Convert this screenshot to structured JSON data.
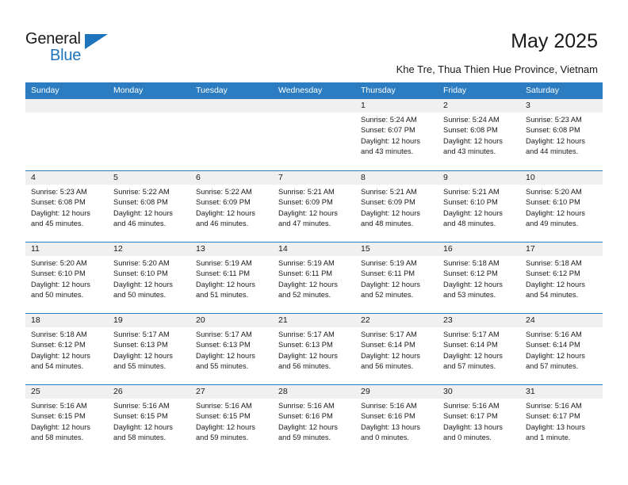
{
  "brand": {
    "name_top": "General",
    "name_bottom": "Blue",
    "accent_color": "#1d74bb"
  },
  "header": {
    "month_title": "May 2025",
    "location": "Khe Tre, Thua Thien Hue Province, Vietnam"
  },
  "colors": {
    "header_blue": "#2b7cc0",
    "day_band_gray": "#f0f0f0",
    "text": "#1a1a1a"
  },
  "weekdays": [
    "Sunday",
    "Monday",
    "Tuesday",
    "Wednesday",
    "Thursday",
    "Friday",
    "Saturday"
  ],
  "weeks": [
    [
      {
        "day": "",
        "empty": true
      },
      {
        "day": "",
        "empty": true
      },
      {
        "day": "",
        "empty": true
      },
      {
        "day": "",
        "empty": true
      },
      {
        "day": "1",
        "sunrise": "Sunrise: 5:24 AM",
        "sunset": "Sunset: 6:07 PM",
        "daylight": "Daylight: 12 hours and 43 minutes."
      },
      {
        "day": "2",
        "sunrise": "Sunrise: 5:24 AM",
        "sunset": "Sunset: 6:08 PM",
        "daylight": "Daylight: 12 hours and 43 minutes."
      },
      {
        "day": "3",
        "sunrise": "Sunrise: 5:23 AM",
        "sunset": "Sunset: 6:08 PM",
        "daylight": "Daylight: 12 hours and 44 minutes."
      }
    ],
    [
      {
        "day": "4",
        "sunrise": "Sunrise: 5:23 AM",
        "sunset": "Sunset: 6:08 PM",
        "daylight": "Daylight: 12 hours and 45 minutes."
      },
      {
        "day": "5",
        "sunrise": "Sunrise: 5:22 AM",
        "sunset": "Sunset: 6:08 PM",
        "daylight": "Daylight: 12 hours and 46 minutes."
      },
      {
        "day": "6",
        "sunrise": "Sunrise: 5:22 AM",
        "sunset": "Sunset: 6:09 PM",
        "daylight": "Daylight: 12 hours and 46 minutes."
      },
      {
        "day": "7",
        "sunrise": "Sunrise: 5:21 AM",
        "sunset": "Sunset: 6:09 PM",
        "daylight": "Daylight: 12 hours and 47 minutes."
      },
      {
        "day": "8",
        "sunrise": "Sunrise: 5:21 AM",
        "sunset": "Sunset: 6:09 PM",
        "daylight": "Daylight: 12 hours and 48 minutes."
      },
      {
        "day": "9",
        "sunrise": "Sunrise: 5:21 AM",
        "sunset": "Sunset: 6:10 PM",
        "daylight": "Daylight: 12 hours and 48 minutes."
      },
      {
        "day": "10",
        "sunrise": "Sunrise: 5:20 AM",
        "sunset": "Sunset: 6:10 PM",
        "daylight": "Daylight: 12 hours and 49 minutes."
      }
    ],
    [
      {
        "day": "11",
        "sunrise": "Sunrise: 5:20 AM",
        "sunset": "Sunset: 6:10 PM",
        "daylight": "Daylight: 12 hours and 50 minutes."
      },
      {
        "day": "12",
        "sunrise": "Sunrise: 5:20 AM",
        "sunset": "Sunset: 6:10 PM",
        "daylight": "Daylight: 12 hours and 50 minutes."
      },
      {
        "day": "13",
        "sunrise": "Sunrise: 5:19 AM",
        "sunset": "Sunset: 6:11 PM",
        "daylight": "Daylight: 12 hours and 51 minutes."
      },
      {
        "day": "14",
        "sunrise": "Sunrise: 5:19 AM",
        "sunset": "Sunset: 6:11 PM",
        "daylight": "Daylight: 12 hours and 52 minutes."
      },
      {
        "day": "15",
        "sunrise": "Sunrise: 5:19 AM",
        "sunset": "Sunset: 6:11 PM",
        "daylight": "Daylight: 12 hours and 52 minutes."
      },
      {
        "day": "16",
        "sunrise": "Sunrise: 5:18 AM",
        "sunset": "Sunset: 6:12 PM",
        "daylight": "Daylight: 12 hours and 53 minutes."
      },
      {
        "day": "17",
        "sunrise": "Sunrise: 5:18 AM",
        "sunset": "Sunset: 6:12 PM",
        "daylight": "Daylight: 12 hours and 54 minutes."
      }
    ],
    [
      {
        "day": "18",
        "sunrise": "Sunrise: 5:18 AM",
        "sunset": "Sunset: 6:12 PM",
        "daylight": "Daylight: 12 hours and 54 minutes."
      },
      {
        "day": "19",
        "sunrise": "Sunrise: 5:17 AM",
        "sunset": "Sunset: 6:13 PM",
        "daylight": "Daylight: 12 hours and 55 minutes."
      },
      {
        "day": "20",
        "sunrise": "Sunrise: 5:17 AM",
        "sunset": "Sunset: 6:13 PM",
        "daylight": "Daylight: 12 hours and 55 minutes."
      },
      {
        "day": "21",
        "sunrise": "Sunrise: 5:17 AM",
        "sunset": "Sunset: 6:13 PM",
        "daylight": "Daylight: 12 hours and 56 minutes."
      },
      {
        "day": "22",
        "sunrise": "Sunrise: 5:17 AM",
        "sunset": "Sunset: 6:14 PM",
        "daylight": "Daylight: 12 hours and 56 minutes."
      },
      {
        "day": "23",
        "sunrise": "Sunrise: 5:17 AM",
        "sunset": "Sunset: 6:14 PM",
        "daylight": "Daylight: 12 hours and 57 minutes."
      },
      {
        "day": "24",
        "sunrise": "Sunrise: 5:16 AM",
        "sunset": "Sunset: 6:14 PM",
        "daylight": "Daylight: 12 hours and 57 minutes."
      }
    ],
    [
      {
        "day": "25",
        "sunrise": "Sunrise: 5:16 AM",
        "sunset": "Sunset: 6:15 PM",
        "daylight": "Daylight: 12 hours and 58 minutes."
      },
      {
        "day": "26",
        "sunrise": "Sunrise: 5:16 AM",
        "sunset": "Sunset: 6:15 PM",
        "daylight": "Daylight: 12 hours and 58 minutes."
      },
      {
        "day": "27",
        "sunrise": "Sunrise: 5:16 AM",
        "sunset": "Sunset: 6:15 PM",
        "daylight": "Daylight: 12 hours and 59 minutes."
      },
      {
        "day": "28",
        "sunrise": "Sunrise: 5:16 AM",
        "sunset": "Sunset: 6:16 PM",
        "daylight": "Daylight: 12 hours and 59 minutes."
      },
      {
        "day": "29",
        "sunrise": "Sunrise: 5:16 AM",
        "sunset": "Sunset: 6:16 PM",
        "daylight": "Daylight: 13 hours and 0 minutes."
      },
      {
        "day": "30",
        "sunrise": "Sunrise: 5:16 AM",
        "sunset": "Sunset: 6:17 PM",
        "daylight": "Daylight: 13 hours and 0 minutes."
      },
      {
        "day": "31",
        "sunrise": "Sunrise: 5:16 AM",
        "sunset": "Sunset: 6:17 PM",
        "daylight": "Daylight: 13 hours and 1 minute."
      }
    ]
  ]
}
